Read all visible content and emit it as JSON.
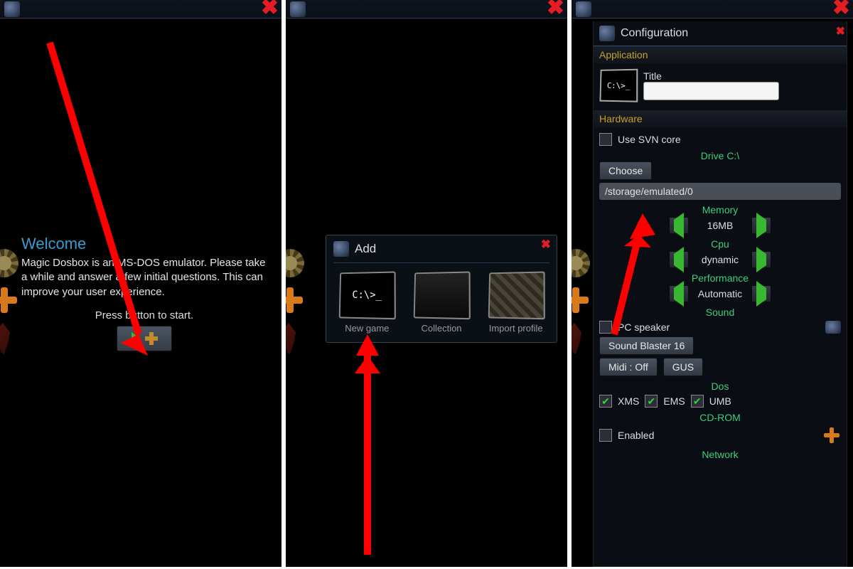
{
  "panel1": {
    "welcome_heading": "Welcome",
    "welcome_body": "Magic Dosbox is an MS-DOS emulator. Please take a while and answer a few initial questions. This can improve your user experience.",
    "start_prompt": "Press button to start."
  },
  "panel2": {
    "dialog_title": "Add",
    "items": [
      {
        "label": "New game",
        "prompt": "C:\\>_"
      },
      {
        "label": "Collection"
      },
      {
        "label": "Import profile"
      }
    ]
  },
  "panel3": {
    "title": "Configuration",
    "application_label": "Application",
    "title_field_label": "Title",
    "title_value": "",
    "dos_prompt": "C:\\>_",
    "hardware_label": "Hardware",
    "svn_label": "Use SVN core",
    "drive_label": "Drive C:\\",
    "choose_label": "Choose",
    "path_value": "/storage/emulated/0",
    "memory_label": "Memory",
    "memory_value": "16MB",
    "cpu_label": "Cpu",
    "cpu_value": "dynamic",
    "performance_label": "Performance",
    "performance_value": "Automatic",
    "sound_label": "Sound",
    "pcspeaker_label": "PC speaker",
    "soundblaster_label": "Sound Blaster 16",
    "midi_label": "Midi : Off",
    "gus_label": "GUS",
    "dos_label": "Dos",
    "xms_label": "XMS",
    "ems_label": "EMS",
    "umb_label": "UMB",
    "cdrom_label": "CD-ROM",
    "enabled_label": "Enabled",
    "network_label": "Network"
  }
}
